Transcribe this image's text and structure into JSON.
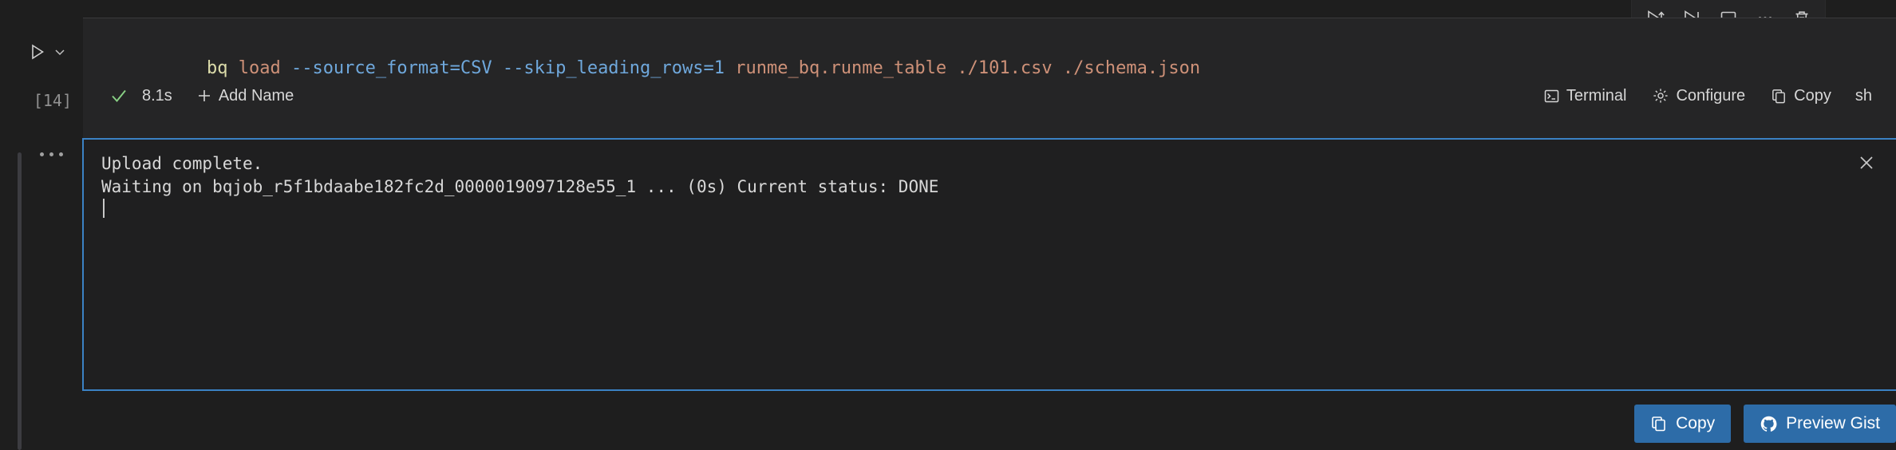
{
  "cell": {
    "execution_count": "[14]",
    "language": "sh",
    "code": {
      "full": "bq load --source_format=CSV --skip_leading_rows=1 runme_bq.runme_table ./101.csv ./schema.json",
      "tokens": [
        {
          "text": "bq ",
          "type": "command"
        },
        {
          "text": "load ",
          "type": "subcommand"
        },
        {
          "text": "--source_format=CSV ",
          "type": "flag"
        },
        {
          "text": "--skip_leading_rows=1 ",
          "type": "flag"
        },
        {
          "text": "runme_bq.runme_table ",
          "type": "argument"
        },
        {
          "text": "./101.csv ",
          "type": "argument"
        },
        {
          "text": "./schema.json",
          "type": "argument"
        }
      ]
    },
    "status": {
      "success_icon": "check-icon",
      "elapsed": "8.1s",
      "add_name_label": "Add Name",
      "add_name_icon": "plus-icon"
    },
    "actions": [
      {
        "label": "Terminal",
        "icon": "terminal-icon"
      },
      {
        "label": "Configure",
        "icon": "gear-icon"
      },
      {
        "label": "Copy",
        "icon": "copy-icon"
      }
    ],
    "toolbar": [
      {
        "name": "run-above-button",
        "icon": "play-up-icon"
      },
      {
        "name": "run-below-button",
        "icon": "play-down-icon"
      },
      {
        "name": "split-cell-button",
        "icon": "split-panel-icon"
      },
      {
        "name": "more-actions-button",
        "icon": "ellipsis-icon"
      },
      {
        "name": "delete-cell-button",
        "icon": "trash-icon"
      }
    ],
    "run_controls": {
      "run_icon": "play-icon",
      "dropdown_icon": "chevron-down-icon"
    }
  },
  "output": {
    "gutter_icon": "ellipsis-icon",
    "close_icon": "close-icon",
    "lines": [
      "Upload complete.",
      "Waiting on bqjob_r5f1bdaabe182fc2d_0000019097128e55_1 ... (0s) Current status: DONE"
    ],
    "text": "Upload complete.\nWaiting on bqjob_r5f1bdaabe182fc2d_0000019097128e55_1 ... (0s) Current status: DONE",
    "buttons": [
      {
        "label": "Copy",
        "icon": "copy-icon"
      },
      {
        "label": "Preview Gist",
        "icon": "github-icon"
      }
    ]
  },
  "colors": {
    "background": "#1e1e1e",
    "cell_background": "#252526",
    "output_background": "#1f1f20",
    "focus_border": "#3b82c4",
    "button_primary": "#2d6ca8",
    "success": "#89d185",
    "flag_token": "#6fa8dc",
    "command_token": "#dcdcaa",
    "argument_token": "#ce9178"
  }
}
